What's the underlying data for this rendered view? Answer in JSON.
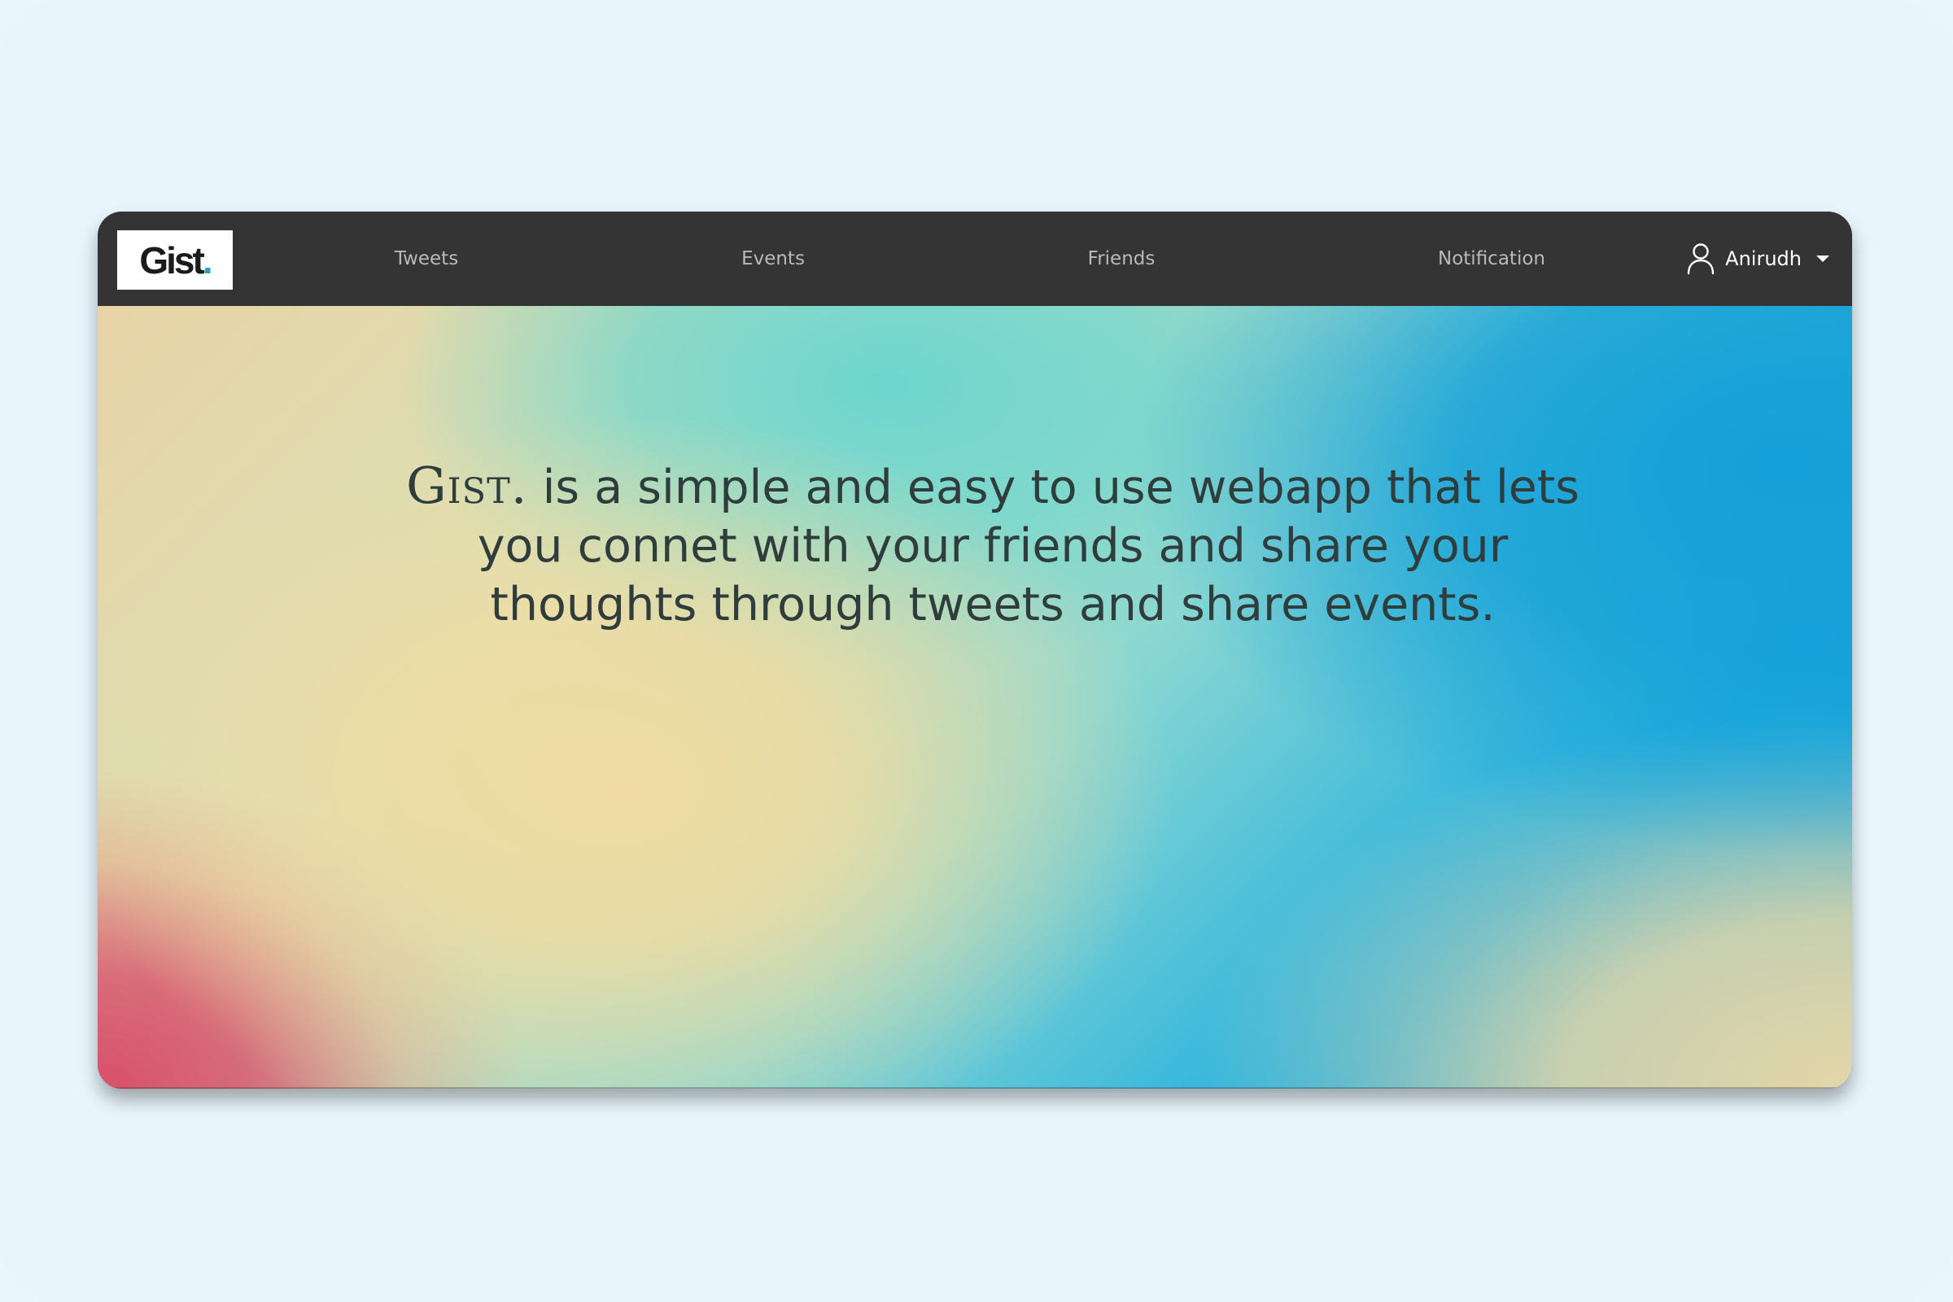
{
  "app": {
    "logo_text": "Gist",
    "logo_dot": ".",
    "brand_color": "#1fa7c9"
  },
  "navbar": {
    "items": [
      {
        "label": "Tweets"
      },
      {
        "label": "Events"
      },
      {
        "label": "Friends"
      },
      {
        "label": "Notification"
      }
    ],
    "user": {
      "name": "Anirudh",
      "icon": "user-icon",
      "dropdown_icon": "caret-down-icon"
    }
  },
  "hero": {
    "brand": "Gist.",
    "description": "is a simple and easy to use webapp that lets you connet with your friends and share your thoughts through tweets and share events."
  }
}
